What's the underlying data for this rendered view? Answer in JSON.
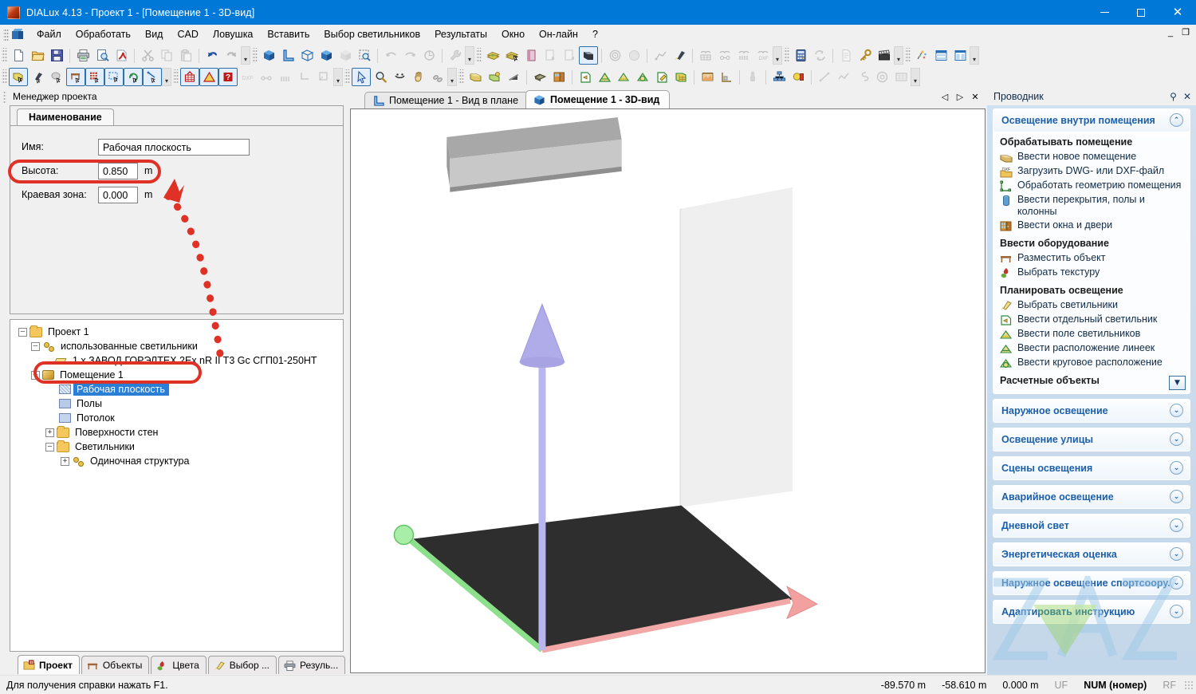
{
  "window": {
    "title": "DIALux 4.13 - Проект 1 - [Помещение 1 - 3D-вид]",
    "minimize": "—",
    "maximize": "□",
    "close": "✕"
  },
  "menu": {
    "items": [
      {
        "label": "Файл"
      },
      {
        "label": "Обработать"
      },
      {
        "label": "Вид"
      },
      {
        "label": "CAD"
      },
      {
        "label": "Ловушка"
      },
      {
        "label": "Вставить"
      },
      {
        "label": "Выбор светильников"
      },
      {
        "label": "Результаты"
      },
      {
        "label": "Окно"
      },
      {
        "label": "Он-лайн"
      },
      {
        "label": "?"
      }
    ],
    "mdi_minimize": "_",
    "mdi_restore": "❐"
  },
  "toolbar": {
    "row1": [
      {
        "name": "new-file-icon"
      },
      {
        "name": "open-file-icon"
      },
      {
        "name": "save-icon"
      },
      {
        "sep": true
      },
      {
        "name": "print-icon"
      },
      {
        "name": "print-preview-icon"
      },
      {
        "name": "export-pdf-icon"
      },
      {
        "sep": true
      },
      {
        "name": "cut-icon",
        "dim": true
      },
      {
        "name": "copy-icon",
        "dim": true
      },
      {
        "name": "paste-icon",
        "dim": true
      },
      {
        "sep": true
      },
      {
        "name": "undo-icon"
      },
      {
        "name": "redo-icon",
        "dim": true
      }
    ],
    "row1b": [
      {
        "name": "view-3d-icon"
      },
      {
        "name": "view-plan-icon"
      },
      {
        "name": "view-wireframe-icon"
      },
      {
        "name": "view-solid-icon"
      },
      {
        "name": "view-shaded-icon",
        "dim": true
      },
      {
        "name": "zoom-window-icon"
      },
      {
        "sep": true
      },
      {
        "name": "rotate-left-icon",
        "dim": true
      },
      {
        "name": "rotate-right-icon",
        "dim": true
      },
      {
        "name": "rotate-free-icon",
        "dim": true
      },
      {
        "sep": true
      },
      {
        "name": "settings-wrench-icon",
        "dim": true
      }
    ],
    "row1c": [
      {
        "name": "money-stack-icon"
      },
      {
        "name": "money-select-icon"
      },
      {
        "name": "book-icon"
      },
      {
        "name": "export-doc-icon",
        "dim": true
      },
      {
        "name": "import-doc-icon",
        "dim": true
      },
      {
        "name": "surface-icon",
        "active": true
      },
      {
        "sep": true
      },
      {
        "name": "target-icon",
        "dim": true
      },
      {
        "name": "sphere-icon",
        "dim": true
      },
      {
        "sep": true
      },
      {
        "name": "measure-path-icon",
        "dim": true
      },
      {
        "name": "flashlight-icon"
      },
      {
        "sep": true
      },
      {
        "name": "glasses-grid-icon",
        "dim": true
      },
      {
        "name": "glasses-line-icon",
        "dim": true
      },
      {
        "name": "glasses-multi-icon",
        "dim": true
      },
      {
        "name": "glasses-dxf-icon",
        "dim": true
      }
    ],
    "row1d": [
      {
        "name": "calculator-icon"
      },
      {
        "name": "refresh-calc-icon",
        "dim": true
      },
      {
        "sep": true
      },
      {
        "name": "document-icon",
        "dim": true
      },
      {
        "name": "key-icon"
      },
      {
        "name": "movie-icon"
      }
    ],
    "row1e": [
      {
        "name": "raytrace-icon"
      },
      {
        "name": "table-rows-icon"
      },
      {
        "name": "table-columns-icon"
      }
    ],
    "row2": [
      {
        "name": "select-room-icon",
        "active": true
      },
      {
        "name": "select-luminaire-icon"
      },
      {
        "name": "select-object-icon"
      },
      {
        "name": "place-furniture-icon",
        "active": true
      },
      {
        "name": "place-texture-icon",
        "active": true
      },
      {
        "name": "rectangle-select-icon",
        "active": true
      },
      {
        "name": "rotate-object-icon",
        "active": true
      },
      {
        "name": "measure-tool-icon",
        "active": true
      }
    ],
    "row2b": [
      {
        "name": "grid-snap-icon",
        "active": true
      },
      {
        "name": "angle-snap-icon",
        "active": true
      },
      {
        "name": "point-snap-icon",
        "active": true
      },
      {
        "name": "dxf-snap-icon",
        "dim": true
      },
      {
        "name": "line-snap-icon",
        "dim": true
      },
      {
        "name": "multi-snap-icon",
        "dim": true
      },
      {
        "name": "corner-snap-icon",
        "dim": true
      },
      {
        "name": "object-snap-icon",
        "dim": true
      }
    ],
    "row2c": [
      {
        "name": "pointer-icon",
        "active": true
      },
      {
        "name": "zoom-icon"
      },
      {
        "name": "orbit-icon"
      },
      {
        "name": "pan-hand-icon"
      },
      {
        "name": "walk-icon"
      }
    ],
    "row2d": [
      {
        "name": "new-room-icon"
      },
      {
        "name": "room-geometry-icon"
      },
      {
        "name": "room-wedge-icon"
      },
      {
        "sep": true
      },
      {
        "name": "ceiling-grid-icon"
      },
      {
        "name": "window-door-icon"
      },
      {
        "sep": true
      },
      {
        "name": "single-luminaire-icon"
      },
      {
        "name": "line-arrangement-icon"
      },
      {
        "name": "field-arrangement-icon"
      },
      {
        "name": "circle-arrangement-icon"
      },
      {
        "name": "luminaire-edit-icon"
      },
      {
        "name": "luminaire-grid-icon"
      },
      {
        "sep": true
      },
      {
        "name": "calc-surface-icon"
      },
      {
        "name": "calc-corner-icon"
      },
      {
        "sep": true
      },
      {
        "name": "person-icon",
        "dim": true
      },
      {
        "sep": true
      },
      {
        "name": "group-icon"
      },
      {
        "name": "light-scene-icon"
      },
      {
        "sep": true
      },
      {
        "name": "line-icon",
        "dim": true
      },
      {
        "name": "polyline-icon",
        "dim": true
      },
      {
        "name": "spline-icon",
        "dim": true
      },
      {
        "name": "circle-icon",
        "dim": true
      },
      {
        "name": "raster-icon",
        "dim": true
      }
    ]
  },
  "left_panel": {
    "caption": "Менеджер проекта",
    "tab_label": "Наименование",
    "fields": [
      {
        "label": "Имя:",
        "value": "Рабочая плоскость",
        "unit": ""
      },
      {
        "label": "Высота:",
        "value": "0.850",
        "unit": "m"
      },
      {
        "label": "Краевая зона:",
        "value": "0.000",
        "unit": "m"
      }
    ],
    "tree": [
      {
        "level": 0,
        "label": "Проект 1",
        "icon": "folder",
        "expander": "-"
      },
      {
        "level": 1,
        "label": "использованные светильники",
        "icon": "lamps",
        "expander": "-"
      },
      {
        "level": 2,
        "label": "1 x ЗАВОД ГОРЭЛТЕХ 2Ex nR II T3 Gc СГП01-250НТ",
        "icon": "luminaire",
        "expander": ""
      },
      {
        "level": 1,
        "label": "Помещение 1",
        "icon": "room",
        "expander": "-"
      },
      {
        "level": 2,
        "label": "Рабочая плоскость",
        "icon": "plane-hatched",
        "expander": "",
        "selected": true
      },
      {
        "level": 2,
        "label": "Полы",
        "icon": "plane-floor",
        "expander": ""
      },
      {
        "level": 2,
        "label": "Потолок",
        "icon": "plane-ceil",
        "expander": ""
      },
      {
        "level": 2,
        "label": "Поверхности стен",
        "icon": "folder",
        "expander": "+"
      },
      {
        "level": 2,
        "label": "Светильники",
        "icon": "folder",
        "expander": "-"
      },
      {
        "level": 3,
        "label": "Одиночная структура",
        "icon": "lamps",
        "expander": "+"
      }
    ],
    "bottom_tabs": [
      {
        "label": "Проект",
        "icon": "project-icon",
        "active": true
      },
      {
        "label": "Объекты",
        "icon": "objects-icon",
        "active": false
      },
      {
        "label": "Цвета",
        "icon": "colors-icon",
        "active": false
      },
      {
        "label": "Выбор ...",
        "icon": "selection-icon",
        "active": false
      },
      {
        "label": "Резуль...",
        "icon": "results-icon",
        "active": false
      }
    ]
  },
  "doc_tabs": [
    {
      "label": "Помещение 1 - Вид в плане",
      "icon": "plan-view-icon",
      "active": false
    },
    {
      "label": "Помещение 1 - 3D-вид",
      "icon": "cube-icon",
      "active": true
    }
  ],
  "mdi_nav": {
    "prev": "◁",
    "next": "▷",
    "close": "✕"
  },
  "right_panel": {
    "caption": "Проводник",
    "pin": "⚲",
    "close": "✕",
    "groups": [
      {
        "title": "Освещение внутри помещения",
        "expanded": true,
        "chevron": "⌃",
        "sections": [
          {
            "heading": "Обрабатывать помещение",
            "items": [
              {
                "label": "Ввести новое помещение",
                "icon": "new-room-icon"
              },
              {
                "label": "Загрузить DWG- или DXF-файл",
                "icon": "dwg-dxf-icon"
              },
              {
                "label": "Обработать геометрию помещения",
                "icon": "room-geometry-icon"
              },
              {
                "label": "Ввести перекрытия, полы и колонны",
                "icon": "column-icon"
              },
              {
                "label": "Ввести окна и двери",
                "icon": "window-door-icon"
              }
            ]
          },
          {
            "heading": "Ввести оборудование",
            "items": [
              {
                "label": "Разместить объект",
                "icon": "furniture-icon"
              },
              {
                "label": "Выбрать текстуру",
                "icon": "texture-icon"
              }
            ]
          },
          {
            "heading": "Планировать освещение",
            "items": [
              {
                "label": "Выбрать светильники",
                "icon": "luminaire-pick-icon"
              },
              {
                "label": "Ввести отдельный светильник",
                "icon": "single-luminaire-icon"
              },
              {
                "label": "Ввести поле светильников",
                "icon": "field-arrangement-icon"
              },
              {
                "label": "Ввести расположение линеек",
                "icon": "line-arrangement-icon"
              },
              {
                "label": "Ввести круговое расположение",
                "icon": "circle-arrangement-icon"
              }
            ]
          },
          {
            "heading": "Расчетные объекты",
            "items": []
          }
        ]
      },
      {
        "title": "Наружное освещение",
        "expanded": false,
        "chevron": "⌄"
      },
      {
        "title": "Освещение улицы",
        "expanded": false,
        "chevron": "⌄"
      },
      {
        "title": "Сцены освещения",
        "expanded": false,
        "chevron": "⌄"
      },
      {
        "title": "Аварийное освещение",
        "expanded": false,
        "chevron": "⌄"
      },
      {
        "title": "Дневной свет",
        "expanded": false,
        "chevron": "⌄"
      },
      {
        "title": "Энергетическая оценка",
        "expanded": false,
        "chevron": "⌄"
      },
      {
        "title": "Наружное освещение спортсоору...",
        "expanded": false,
        "chevron": "⌄"
      },
      {
        "title": "Адаптировать инструкцию",
        "expanded": false,
        "chevron": "⌄"
      }
    ],
    "scroll_down": "▼"
  },
  "statusbar": {
    "hint": "Для получения справки нажать F1.",
    "coord_x": "-89.570 m",
    "coord_y": "-58.610 m",
    "coord_z": "0.000 m",
    "uf": "UF",
    "num": "NUM (номер)",
    "rf": "RF"
  },
  "colors": {
    "title_bar": "#0078d7",
    "accent_blue": "#1c5fa8",
    "selection": "#2a7fd4",
    "annotation_red": "#e03127",
    "panel_bg": "#f0f0f0",
    "explorer_bg": "#cfdfef"
  }
}
